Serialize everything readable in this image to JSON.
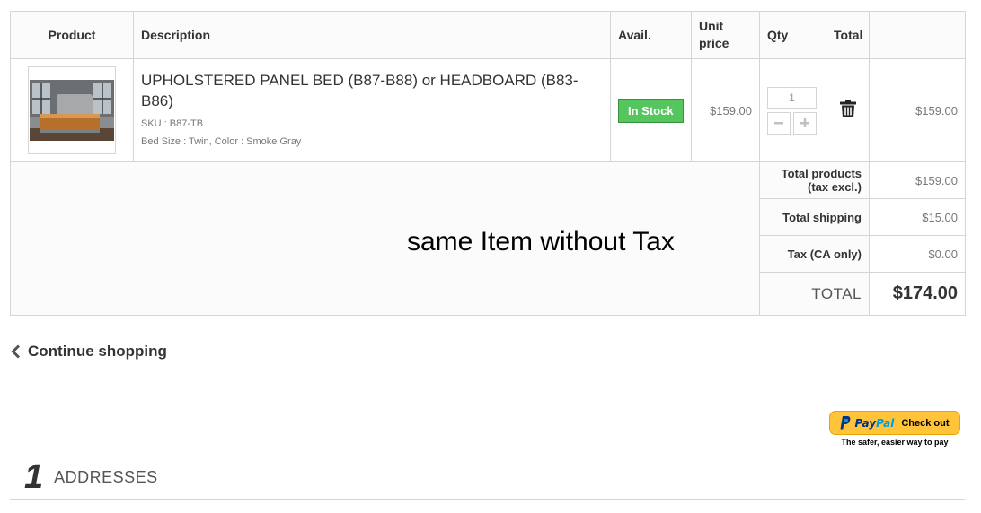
{
  "columns": {
    "product": "Product",
    "description": "Description",
    "avail": "Avail.",
    "unit_price": "Unit price",
    "qty": "Qty",
    "total": "Total"
  },
  "item": {
    "image_icon": "bed-product-photo",
    "name": "UPHOLSTERED PANEL BED (B87-B88) or HEADBOARD (B83-B86)",
    "sku": "SKU : B87-TB",
    "attributes": "Bed Size : Twin, Color : Smoke Gray",
    "availability": "In Stock",
    "unit_price": "$159.00",
    "quantity": "1",
    "total": "$159.00"
  },
  "summary": {
    "products_label": "Total products (tax excl.)",
    "products_value": "$159.00",
    "shipping_label": "Total shipping",
    "shipping_value": "$15.00",
    "tax_label": "Tax (CA only)",
    "tax_value": "$0.00",
    "total_label": "TOTAL",
    "total_value": "$174.00"
  },
  "annotation": "same Item without Tax",
  "continue_label": "Continue shopping",
  "paypal": {
    "logo_pay": "Pay",
    "logo_pal": "Pal",
    "button_label": "Check out",
    "tagline": "The safer, easier way to pay"
  },
  "step": {
    "number": "1",
    "title": "ADDRESSES"
  },
  "colors": {
    "stock_green": "#55c65e",
    "paypal_yellow": "#ffc439",
    "paypal_blue": "#003087",
    "paypal_light_blue": "#009cde"
  }
}
